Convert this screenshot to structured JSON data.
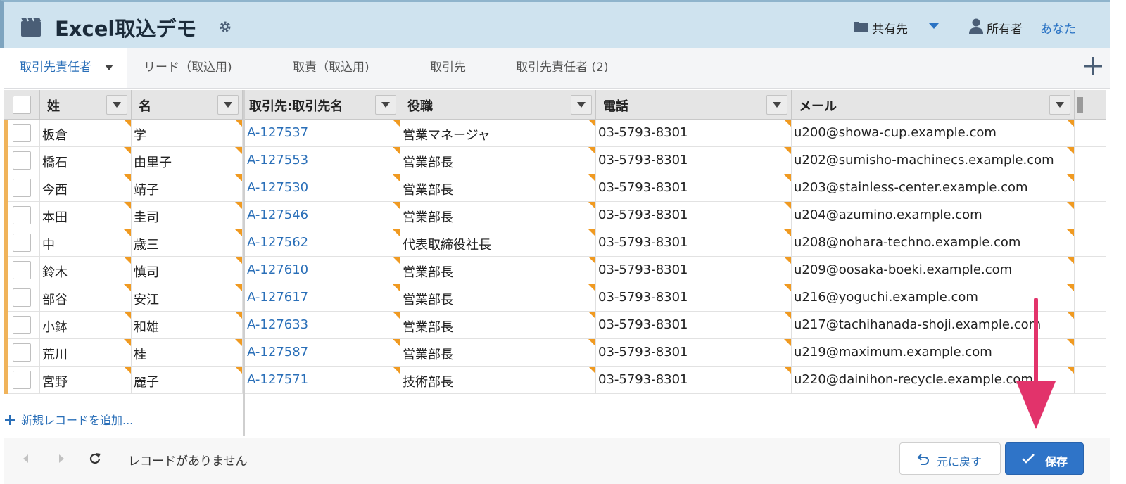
{
  "header": {
    "title": "Excel取込デモ",
    "share_label": "共有先",
    "owner_label": "所有者",
    "owner_name": "あなた"
  },
  "tabs": [
    {
      "label": "取引先責任者",
      "active": true
    },
    {
      "label": "リード（取込用)",
      "active": false
    },
    {
      "label": "取責（取込用)",
      "active": false
    },
    {
      "label": "取引先",
      "active": false
    },
    {
      "label": "取引先責任者 (2)",
      "active": false
    }
  ],
  "grid": {
    "columns": [
      "姓",
      "名",
      "取引先:取引先名",
      "役職",
      "電話",
      "メール"
    ],
    "rows": [
      {
        "last": "板倉",
        "first": "学",
        "account": "A-127537",
        "title": "営業マネージャ",
        "phone": "03-5793-8301",
        "email": "u200@showa-cup.example.com"
      },
      {
        "last": "橋石",
        "first": "由里子",
        "account": "A-127553",
        "title": "営業部長",
        "phone": "03-5793-8301",
        "email": "u202@sumisho-machinecs.example.com"
      },
      {
        "last": "今西",
        "first": "靖子",
        "account": "A-127530",
        "title": "営業部長",
        "phone": "03-5793-8301",
        "email": "u203@stainless-center.example.com"
      },
      {
        "last": "本田",
        "first": "圭司",
        "account": "A-127546",
        "title": "営業部長",
        "phone": "03-5793-8301",
        "email": "u204@azumino.example.com"
      },
      {
        "last": "中",
        "first": "歳三",
        "account": "A-127562",
        "title": "代表取締役社長",
        "phone": "03-5793-8301",
        "email": "u208@nohara-techno.example.com"
      },
      {
        "last": "鈴木",
        "first": "慎司",
        "account": "A-127610",
        "title": "営業部長",
        "phone": "03-5793-8301",
        "email": "u209@oosaka-boeki.example.com"
      },
      {
        "last": "部谷",
        "first": "安江",
        "account": "A-127617",
        "title": "営業部長",
        "phone": "03-5793-8301",
        "email": "u216@yoguchi.example.com"
      },
      {
        "last": "小鉢",
        "first": "和雄",
        "account": "A-127633",
        "title": "営業部長",
        "phone": "03-5793-8301",
        "email": "u217@tachihanada-shoji.example.com"
      },
      {
        "last": "荒川",
        "first": "桂",
        "account": "A-127587",
        "title": "営業部長",
        "phone": "03-5793-8301",
        "email": "u219@maximum.example.com"
      },
      {
        "last": "宮野",
        "first": "麗子",
        "account": "A-127571",
        "title": "技術部長",
        "phone": "03-5793-8301",
        "email": "u220@dainihon-recycle.example.com"
      }
    ],
    "add_record_label": "新規レコードを追加..."
  },
  "footer": {
    "status": "レコードがありません",
    "revert_label": "元に戻す",
    "save_label": "保存"
  },
  "colors": {
    "header_bg": "#cfe3ef",
    "link": "#2a6fb8",
    "save_button": "#2f74c8",
    "row_flag": "#f0b35a",
    "cell_marker": "#f09a21",
    "annotation_arrow": "#e2336b"
  },
  "icons": [
    "clapperboard-icon",
    "gear-icon",
    "folder-icon",
    "chevron-down-icon",
    "user-icon",
    "plus-icon",
    "chevron-left-icon",
    "chevron-right-icon",
    "refresh-icon",
    "undo-icon",
    "check-icon"
  ]
}
